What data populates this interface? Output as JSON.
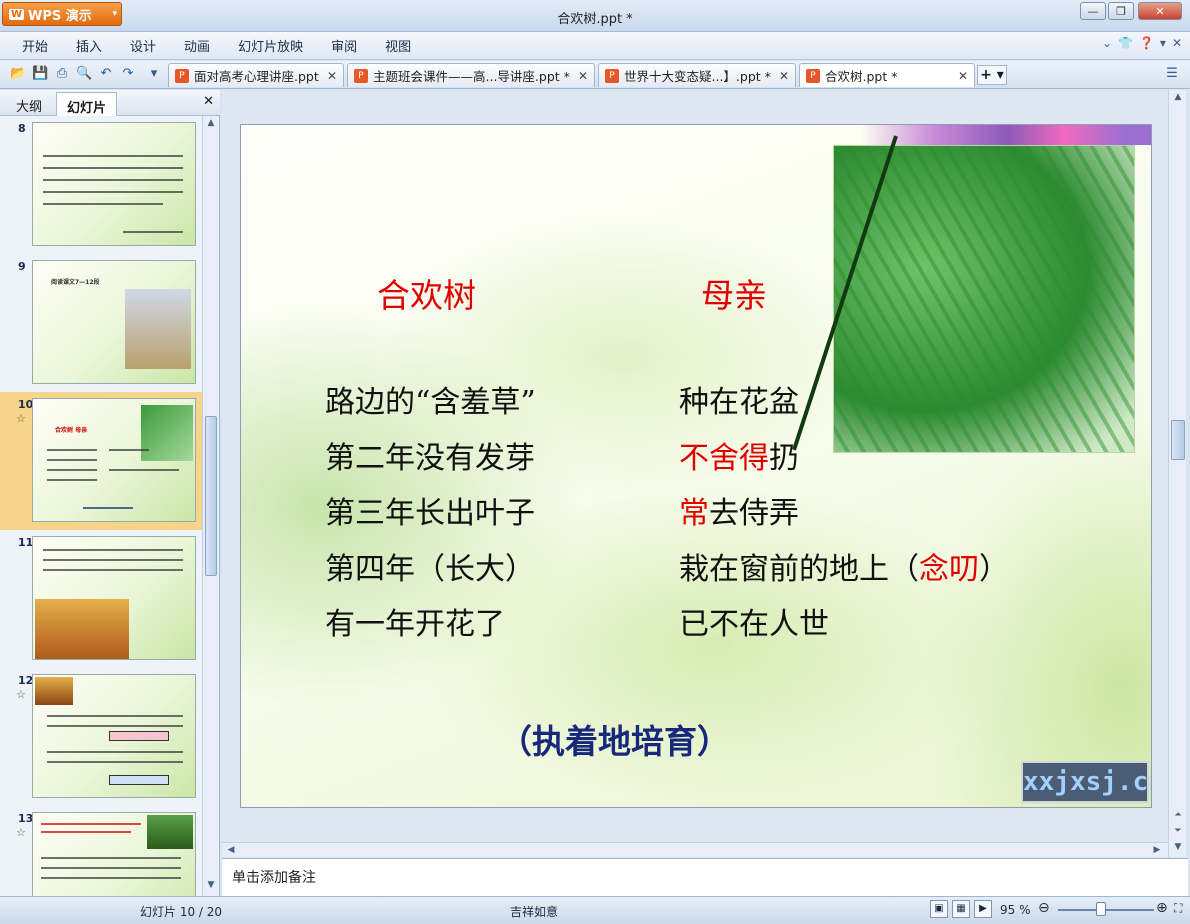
{
  "app": {
    "brand": "WPS 演示",
    "window_title": "合欢树.ppt *"
  },
  "menu": [
    "开始",
    "插入",
    "设计",
    "动画",
    "幻灯片放映",
    "审阅",
    "视图"
  ],
  "doc_tabs": [
    {
      "label": "面对高考心理讲座.ppt *",
      "active": false
    },
    {
      "label": "主题班会课件——高...导讲座.ppt *",
      "active": false
    },
    {
      "label": "世界十大变态疑...】.ppt *",
      "active": false
    },
    {
      "label": "合欢树.ppt *",
      "active": true
    }
  ],
  "panel": {
    "tab_outline": "大纲",
    "tab_slides": "幻灯片"
  },
  "thumbnails": [
    {
      "num": "8",
      "star": false,
      "caption": ""
    },
    {
      "num": "9",
      "star": false,
      "caption": "阅读课文7—12段"
    },
    {
      "num": "10",
      "star": true,
      "caption": "合欢树   母亲"
    },
    {
      "num": "11",
      "star": false,
      "caption": ""
    },
    {
      "num": "12",
      "star": true,
      "caption": ""
    },
    {
      "num": "13",
      "star": true,
      "caption": ""
    }
  ],
  "slide": {
    "left_head": "合欢树",
    "right_head": "母亲",
    "left_lines": [
      "路边的“含羞草”",
      "第二年没有发芽",
      "第三年长出叶子",
      "第四年（长大）",
      "有一年开花了"
    ],
    "right_lines": [
      {
        "pre": "",
        "red": "",
        "post": "种在花盆"
      },
      {
        "pre": "",
        "red": "不舍得",
        "post": "扔"
      },
      {
        "pre": "",
        "red": "常",
        "post": "去侍弄"
      },
      {
        "pre": "栽在窗前的地上（",
        "red": "念叨",
        "post": "）"
      },
      {
        "pre": "",
        "red": "",
        "post": "已不在人世"
      }
    ],
    "bottom": "（执着地培育）",
    "watermark": "xxjxsj.cn"
  },
  "notes_placeholder": "单击添加备注",
  "status": {
    "slide_info": "幻灯片 10 / 20",
    "theme": "吉祥如意",
    "zoom": "95 %"
  },
  "colors": {
    "accent_red": "#e00000",
    "bottom_blue": "#17287a",
    "wps_orange": "#e36a0c"
  }
}
